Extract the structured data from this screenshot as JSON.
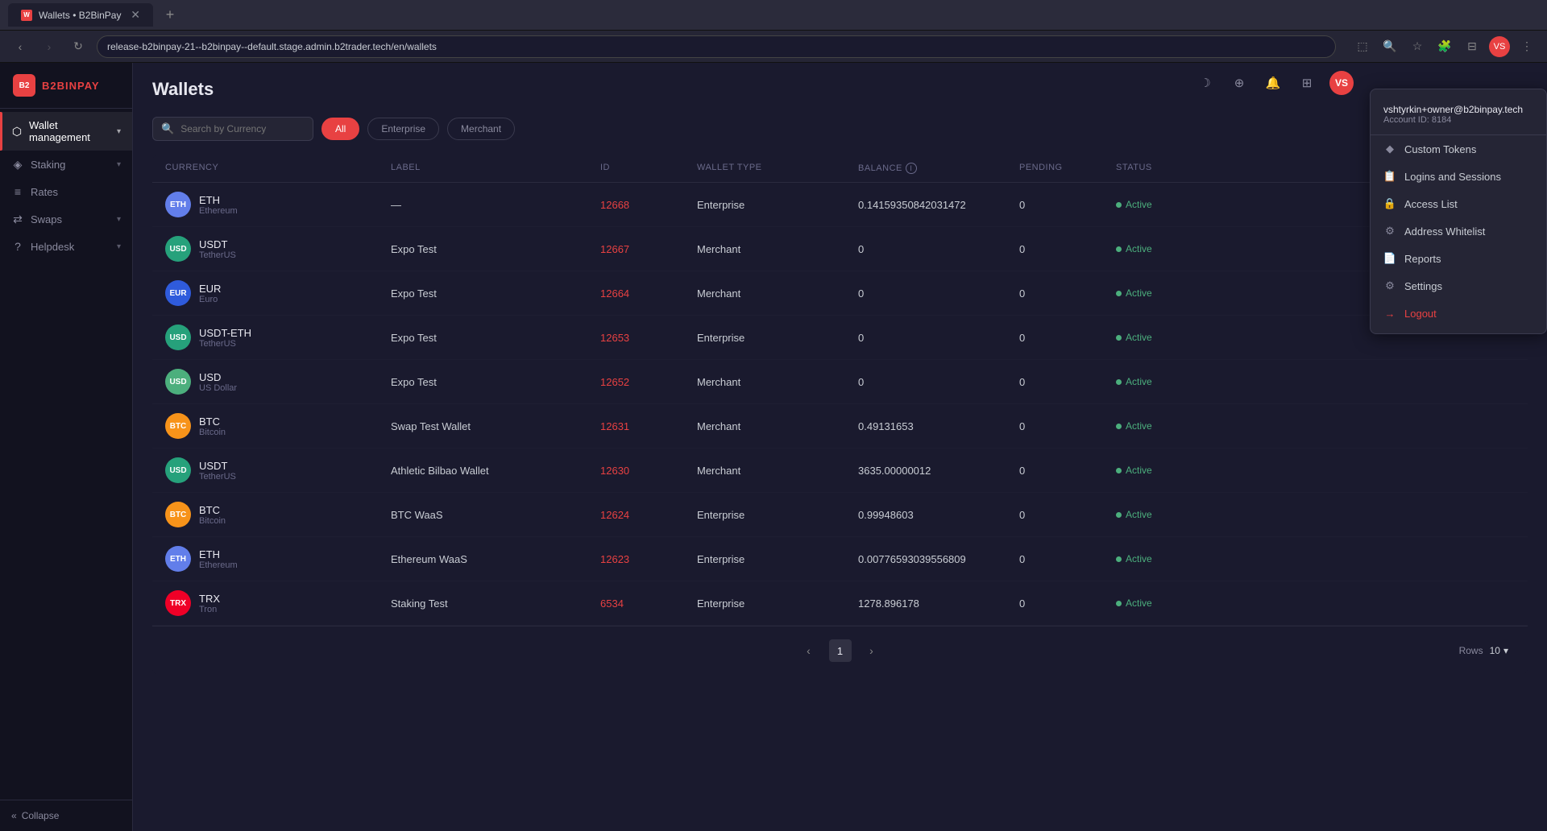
{
  "browser": {
    "tab_title": "Wallets • B2BinPay",
    "tab_favicon": "W",
    "address": "release-b2binpay-21--b2binpay--default.stage.admin.b2trader.tech/en/wallets"
  },
  "app": {
    "logo_text": "B2BINPAY"
  },
  "sidebar": {
    "items": [
      {
        "id": "wallet-management",
        "label": "Wallet management",
        "icon": "⬡",
        "has_chevron": true,
        "active": true
      },
      {
        "id": "staking",
        "label": "Staking",
        "icon": "◈",
        "has_chevron": true
      },
      {
        "id": "rates",
        "label": "Rates",
        "icon": "≡",
        "has_chevron": false
      },
      {
        "id": "swaps",
        "label": "Swaps",
        "icon": "⇄",
        "has_chevron": true
      },
      {
        "id": "helpdesk",
        "label": "Helpdesk",
        "icon": "?",
        "has_chevron": true
      }
    ],
    "collapse_label": "Collapse"
  },
  "header": {
    "user_email": "vshtyrkin+owner@b2binpay.tech",
    "account_id_label": "Account ID: 8184",
    "avatar_initials": "VS"
  },
  "context_menu": {
    "items": [
      {
        "id": "custom-tokens",
        "label": "Custom Tokens",
        "icon": "🔷"
      },
      {
        "id": "logins-sessions",
        "label": "Logins and Sessions",
        "icon": "📋"
      },
      {
        "id": "access-list",
        "label": "Access List",
        "icon": "🔒"
      },
      {
        "id": "address-whitelist",
        "label": "Address Whitelist",
        "icon": "⚙"
      },
      {
        "id": "reports",
        "label": "Reports",
        "icon": "📄"
      },
      {
        "id": "settings",
        "label": "Settings",
        "icon": "⚙"
      },
      {
        "id": "logout",
        "label": "Logout",
        "icon": "→",
        "is_logout": true
      }
    ]
  },
  "page": {
    "title": "Wallets"
  },
  "toolbar": {
    "search_placeholder": "Search by Currency",
    "tabs": [
      "All",
      "Enterprise",
      "Merchant"
    ],
    "active_tab": "All"
  },
  "table": {
    "columns": [
      "Currency",
      "Label",
      "ID",
      "Wallet type",
      "Balance",
      "Pending",
      "Status"
    ],
    "rows": [
      {
        "currency_code": "ETH",
        "currency_name": "Ethereum",
        "label": "—",
        "id": "12668",
        "wallet_type": "Enterprise",
        "balance": "0.14159350842031472",
        "pending": "0",
        "status": "Active",
        "icon_bg": "#627eea"
      },
      {
        "currency_code": "USDT",
        "currency_name": "TetherUS",
        "label": "Expo Test",
        "id": "12667",
        "wallet_type": "Merchant",
        "balance": "0",
        "pending": "0",
        "status": "Active",
        "icon_bg": "#26a17b"
      },
      {
        "currency_code": "EUR",
        "currency_name": "Euro",
        "label": "Expo Test",
        "id": "12664",
        "wallet_type": "Merchant",
        "balance": "0",
        "pending": "0",
        "status": "Active",
        "icon_bg": "#2f5bdc"
      },
      {
        "currency_code": "USDT-ETH",
        "currency_name": "TetherUS",
        "label": "Expo Test",
        "id": "12653",
        "wallet_type": "Enterprise",
        "balance": "0",
        "pending": "0",
        "status": "Active",
        "icon_bg": "#26a17b"
      },
      {
        "currency_code": "USD",
        "currency_name": "US Dollar",
        "label": "Expo Test",
        "id": "12652",
        "wallet_type": "Merchant",
        "balance": "0",
        "pending": "0",
        "status": "Active",
        "icon_bg": "#4caf7d"
      },
      {
        "currency_code": "BTC",
        "currency_name": "Bitcoin",
        "label": "Swap Test Wallet",
        "id": "12631",
        "wallet_type": "Merchant",
        "balance": "0.49131653",
        "pending": "0",
        "status": "Active",
        "icon_bg": "#f7931a"
      },
      {
        "currency_code": "USDT",
        "currency_name": "TetherUS",
        "label": "Athletic Bilbao Wallet",
        "id": "12630",
        "wallet_type": "Merchant",
        "balance": "3635.00000012",
        "pending": "0",
        "status": "Active",
        "icon_bg": "#26a17b"
      },
      {
        "currency_code": "BTC",
        "currency_name": "Bitcoin",
        "label": "BTC WaaS",
        "id": "12624",
        "wallet_type": "Enterprise",
        "balance": "0.99948603",
        "pending": "0",
        "status": "Active",
        "icon_bg": "#f7931a"
      },
      {
        "currency_code": "ETH",
        "currency_name": "Ethereum",
        "label": "Ethereum WaaS",
        "id": "12623",
        "wallet_type": "Enterprise",
        "balance": "0.00776593039556809",
        "pending": "0",
        "status": "Active",
        "icon_bg": "#627eea"
      },
      {
        "currency_code": "TRX",
        "currency_name": "Tron",
        "label": "Staking Test",
        "id": "6534",
        "wallet_type": "Enterprise",
        "balance": "1278.896178",
        "pending": "0",
        "status": "Active",
        "icon_bg": "#ef0027"
      }
    ]
  },
  "pagination": {
    "current_page": "1",
    "rows_label": "Rows",
    "rows_value": "10"
  }
}
